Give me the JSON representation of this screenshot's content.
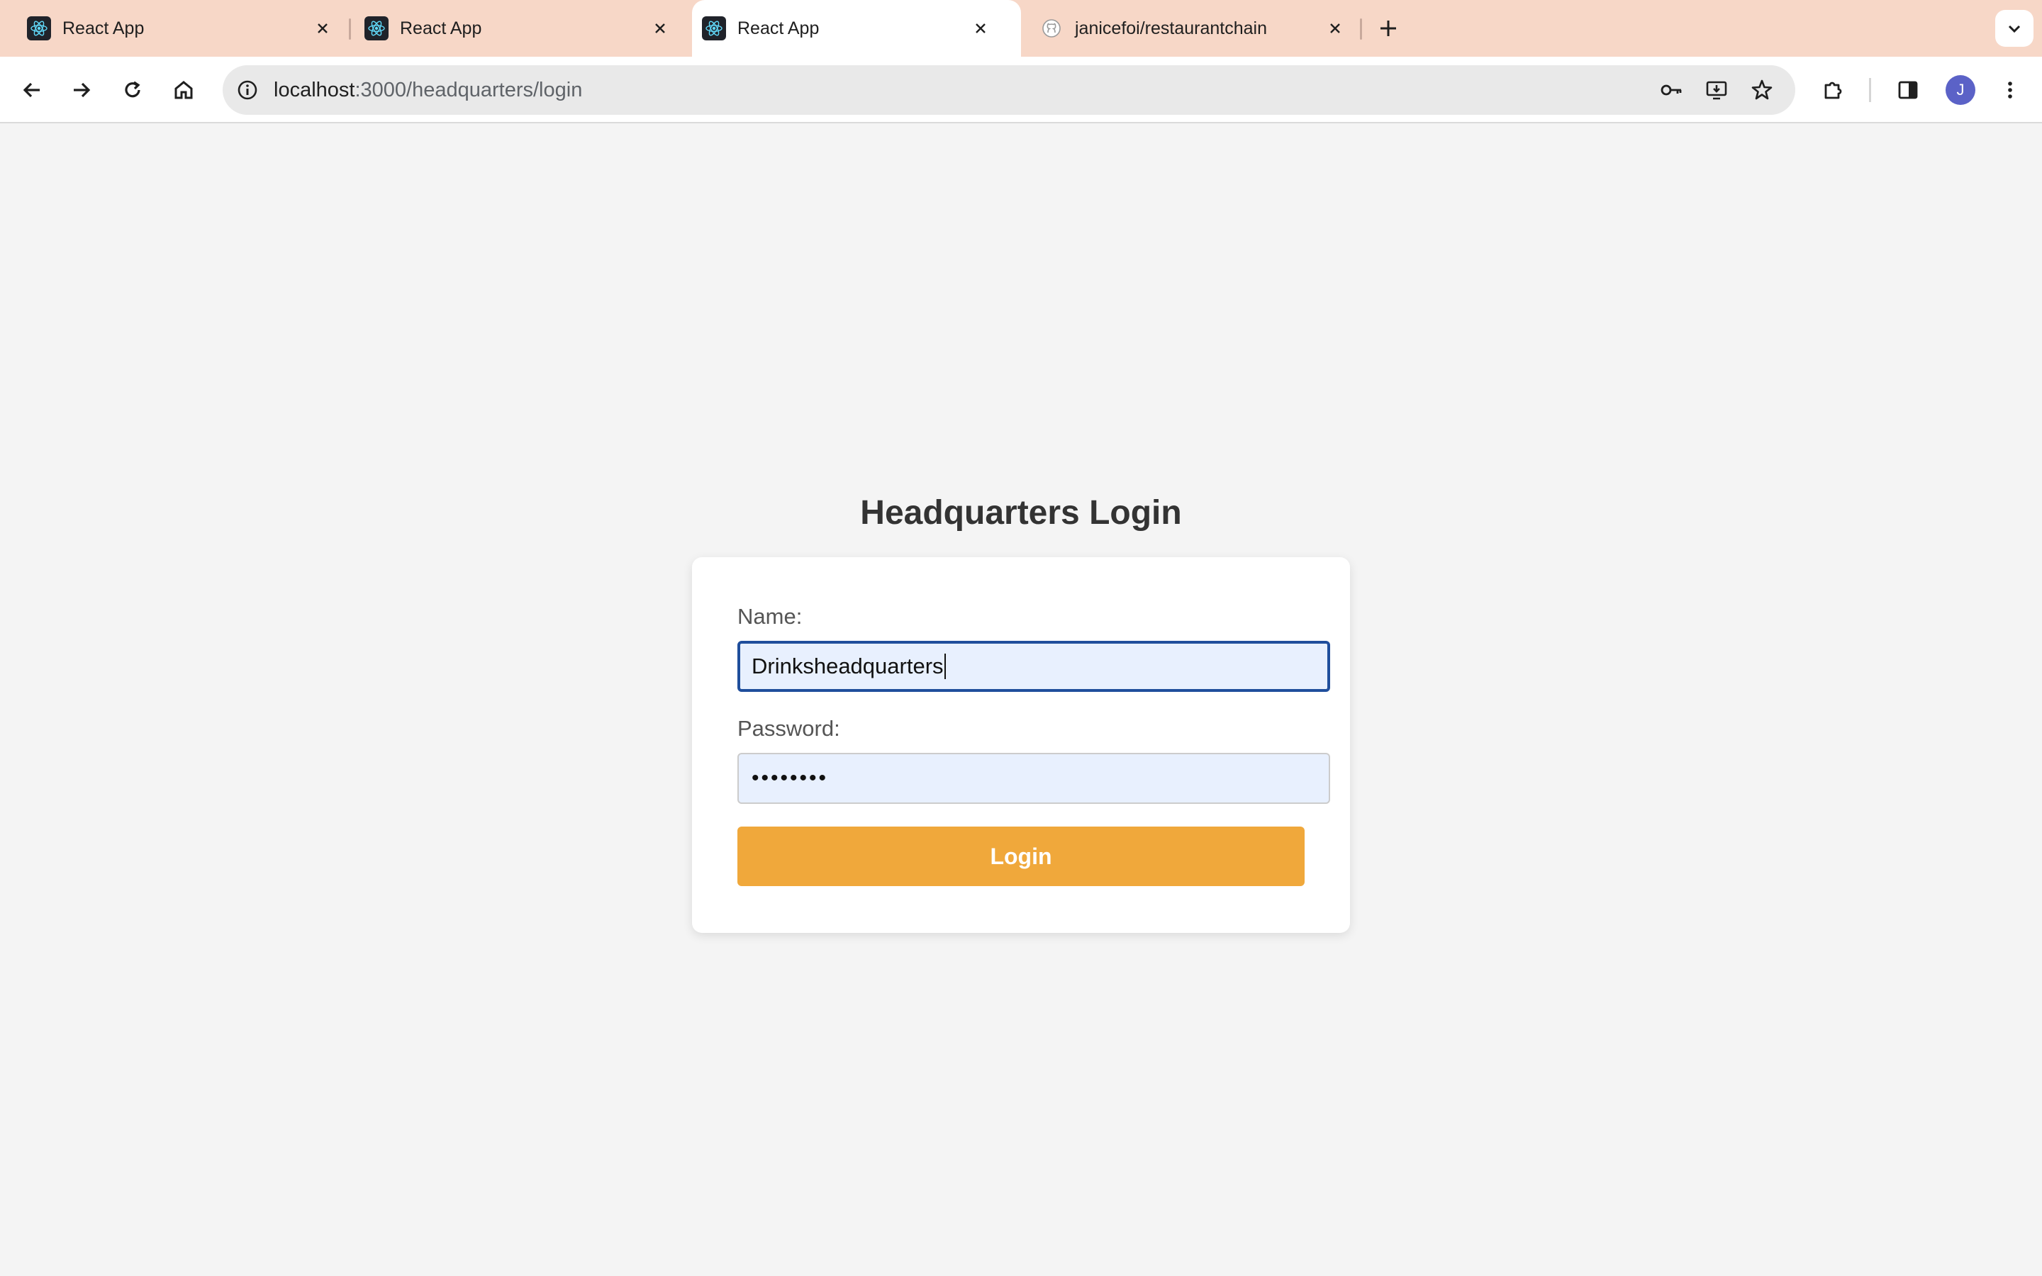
{
  "browser": {
    "tabs": [
      {
        "title": "React App",
        "favicon": "react-icon",
        "active": false
      },
      {
        "title": "React App",
        "favicon": "react-icon",
        "active": false
      },
      {
        "title": "React App",
        "favicon": "react-icon",
        "active": true
      },
      {
        "title": "janicefoi/restaurantchain",
        "favicon": "github-icon",
        "active": false
      }
    ],
    "url_host": "localhost",
    "url_path": ":3000/headquarters/login",
    "profile_initial": "J",
    "colors": {
      "tabstrip": "#f7d7c7",
      "avatar": "#5b62c7"
    }
  },
  "page": {
    "heading": "Headquarters Login",
    "name_label": "Name:",
    "name_value": "Drinksheadquarters",
    "password_label": "Password:",
    "password_value": "••••••••",
    "login_label": "Login",
    "colors": {
      "button": "#f0a83b",
      "field_fill": "#e8f0fe",
      "focus_border": "#1f4e9c"
    }
  }
}
